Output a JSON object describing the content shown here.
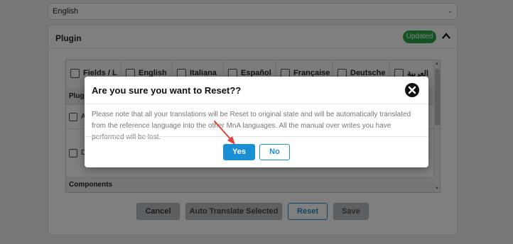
{
  "language_select": {
    "value": "English"
  },
  "plugin_panel": {
    "title": "Plugin",
    "badge": "Updated",
    "table": {
      "columns": [
        "Fields / L",
        "English",
        "Italiana",
        "Español",
        "Française",
        "Deutsche",
        "العربية"
      ],
      "section_plugin": "Plugin",
      "row1_text": "Al",
      "row2_text": "De",
      "section_components": "Components"
    },
    "buttons": {
      "cancel": "Cancel",
      "auto_translate": "Auto Translate Selected",
      "reset": "Reset",
      "save": "Save"
    }
  },
  "modal": {
    "title": "Are you sure you want to Reset??",
    "body": "Please note that all your translations will be Reset to original state and will be automatically translated from the reference language into the other MnA languages. All the manual over writes you have performed will be lost.",
    "yes": "Yes",
    "no": "No"
  },
  "colors": {
    "accent": "#1a8fd4",
    "badge": "#28a745",
    "arrow": "#e0403a"
  },
  "icons": {
    "collapse": "chevron-up-icon",
    "close": "close-circle-icon",
    "dropdown": "chevron-down-icon"
  }
}
